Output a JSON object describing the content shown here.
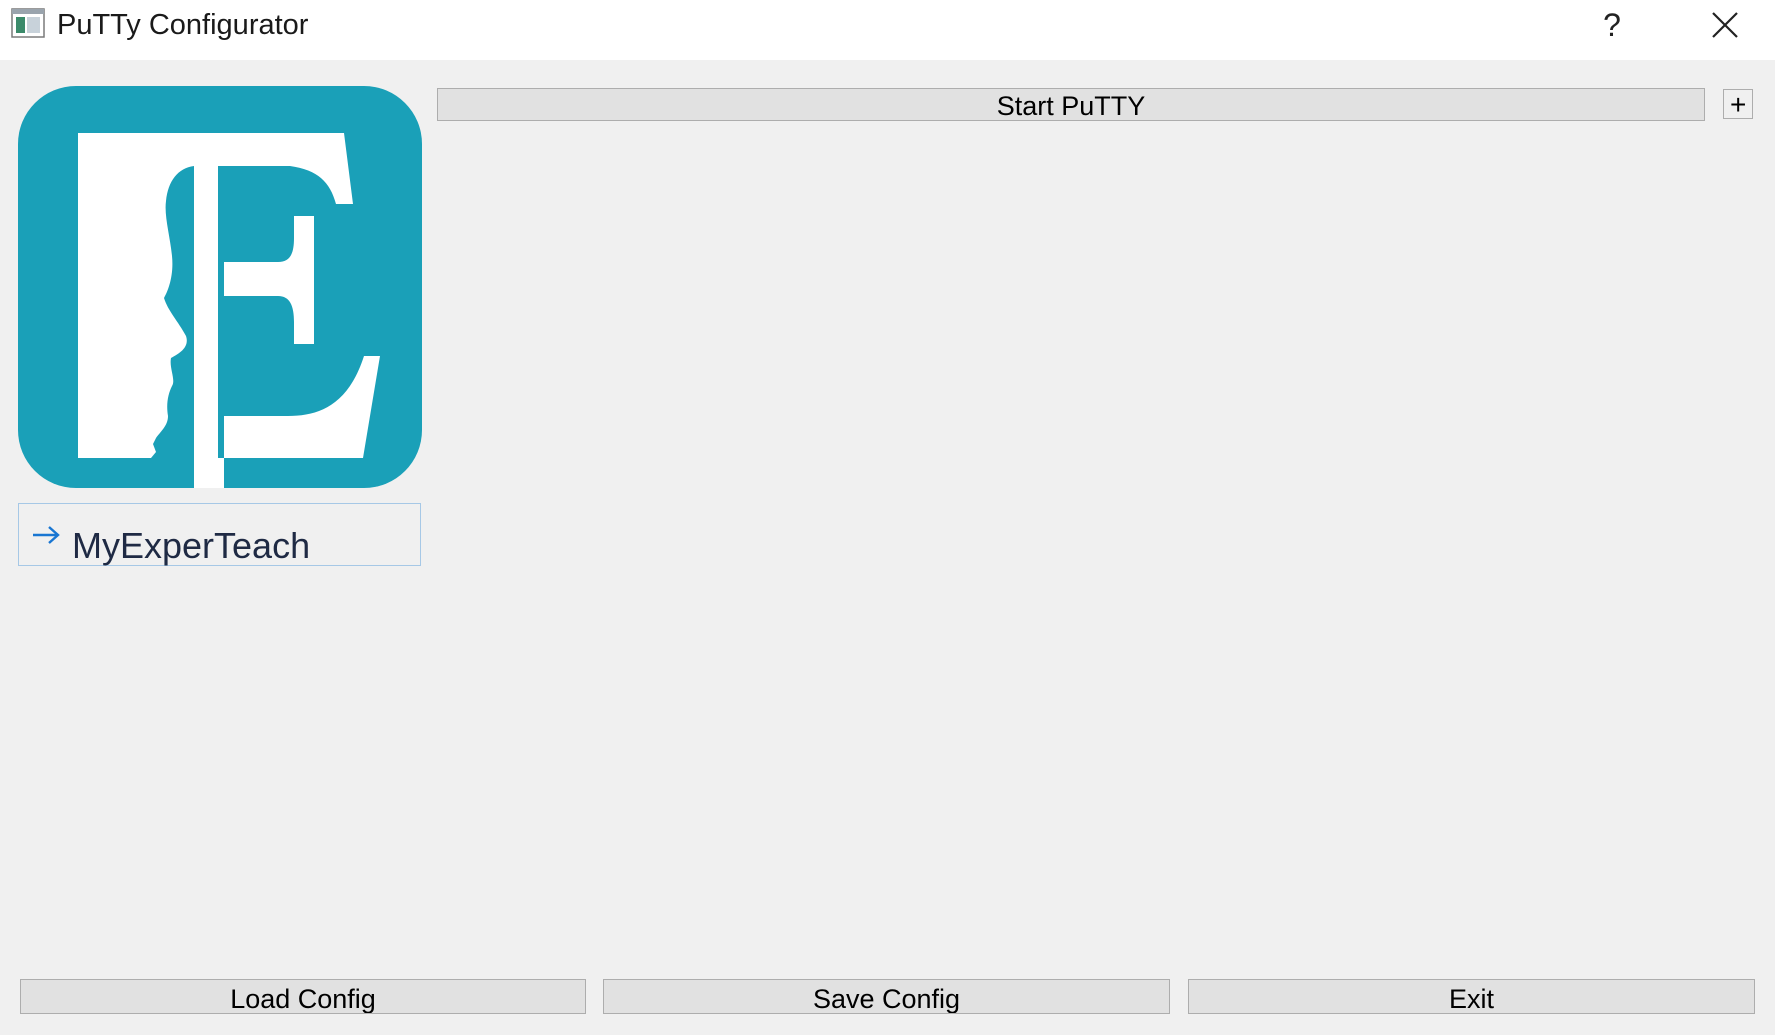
{
  "window": {
    "title": "PuTTy Configurator",
    "help_label": "?"
  },
  "colors": {
    "logo_bg": "#1aa0b8",
    "logo_fg": "#ffffff",
    "button_bg": "#e1e1e1",
    "window_bg": "#f0f0f0",
    "selection_border": "#a6c8e6"
  },
  "profiles": [
    {
      "label": "MyExperTeach",
      "icon": "arrow-right-icon"
    }
  ],
  "toolbar": {
    "start_label": "Start PuTTY",
    "add_label": "+"
  },
  "footer": {
    "load_label": "Load Config",
    "save_label": "Save Config",
    "exit_label": "Exit"
  }
}
